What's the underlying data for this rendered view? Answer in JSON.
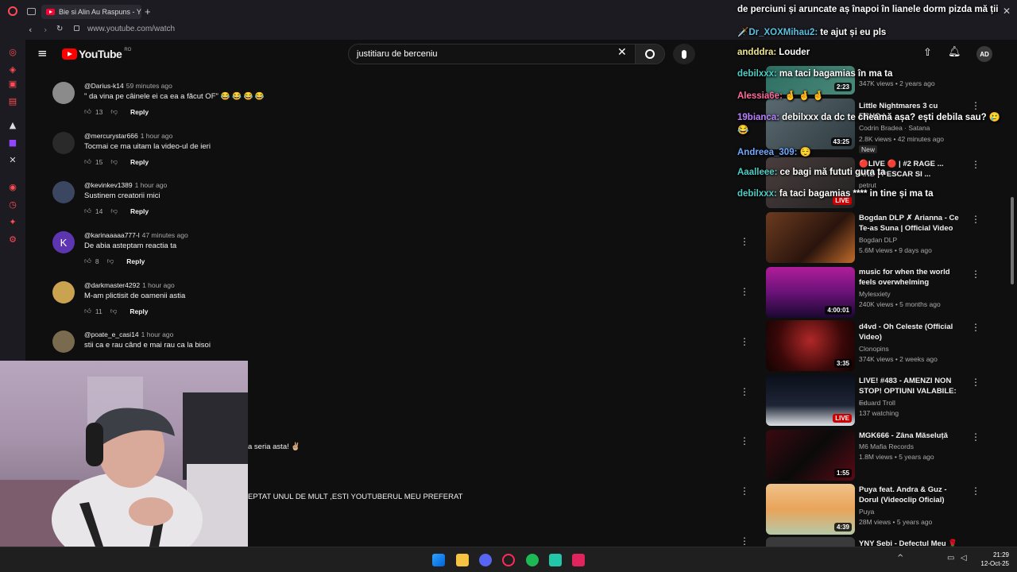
{
  "browser": {
    "tab_title": "Bie si Alin Au Raspuns - Y",
    "url": "www.youtube.com/watch",
    "tab_plus": "+"
  },
  "youtube": {
    "logo_text": "YouTube",
    "region": "RO",
    "search_value": "justitiaru de berceniu",
    "avatar_initials": "AD"
  },
  "comments": [
    {
      "user": "@Darius-k14",
      "time": "59 minutes ago",
      "text": "\" da vina pe câinele ei ca ea a făcut OF\" 😂 😂 😂 😂",
      "likes": "13",
      "reply": "Reply",
      "avatar": ""
    },
    {
      "user": "@mercurystar666",
      "time": "1 hour ago",
      "text": "Tocmai ce ma uitam la video-ul de ieri",
      "likes": "15",
      "reply": "Reply",
      "avatar": ""
    },
    {
      "user": "@kevinkev1389",
      "time": "1 hour ago",
      "text": "Sustinem creatorii mici",
      "likes": "14",
      "reply": "Reply",
      "avatar": ""
    },
    {
      "user": "@karinaaaaa777-l",
      "time": "47 minutes ago",
      "text": "De abia asteptam reactia ta",
      "likes": "8",
      "reply": "Reply",
      "avatar": "K"
    },
    {
      "user": "@darkmaster4292",
      "time": "1 hour ago",
      "text": "M-am plictisit de oamenii astia",
      "likes": "11",
      "reply": "Reply",
      "avatar": ""
    },
    {
      "user": "@poate_e_casi14",
      "time": "1 hour ago",
      "text": "stii ca e rau când e mai rau ca la bisoi",
      "likes": "",
      "reply": "",
      "avatar": ""
    }
  ],
  "partial_comments": [
    "a seria asta! ✌🏼",
    "EPTAT UNUL DE MULT ,ESTI YOUTUBERUL MEU PREFERAT"
  ],
  "videos": [
    {
      "title": "",
      "channel": "",
      "stats": "347K views • 2 years ago",
      "duration": "2:23",
      "live": false
    },
    {
      "title": "Little Nightmares 3 cu ECHO | ...",
      "channel": "Codrin Bradea · Satana",
      "stats": "2.8K views • 42 minutes ago",
      "badge": "New",
      "duration": "43:25",
      "live": false
    },
    {
      "title": "🔴LIVE 🔴 | #2 RAGE ... AND | PESCAR SI ...",
      "channel": "petrut",
      "stats": "",
      "duration": "",
      "live": true,
      "live_label": "LIVE"
    },
    {
      "title": "Bogdan DLP ✗ Arianna - Ce Te-as Suna | Official Video",
      "channel": "Bogdan DLP",
      "stats": "5.6M views • 9 days ago",
      "duration": "",
      "live": false
    },
    {
      "title": "music for when the world feels overwhelming",
      "channel": "Mylesxiety",
      "stats": "240K views • 5 months ago",
      "duration": "4:00:01",
      "live": false
    },
    {
      "title": "d4vd - Oh Celeste (Official Video)",
      "channel": "Clonopins",
      "stats": "374K views • 2 weeks ago",
      "duration": "3:35",
      "live": false
    },
    {
      "title": "LIVE! #483 - AMENZI NON STOP! OPTIUNI VALABILE: ...",
      "channel": "Eduard Troll",
      "stats": "137 watching",
      "duration": "",
      "live": true,
      "live_label": "LIVE"
    },
    {
      "title": "MGK666 - Zâna Măseluță",
      "channel": "M6 Mafia Records",
      "stats": "1.8M views • 5 years ago",
      "duration": "1:55",
      "live": false
    },
    {
      "title": "Puya feat. Andra & Guz - Dorul (Videoclip Oficial)",
      "channel": "Puya",
      "stats": "28M views • 5 years ago",
      "duration": "4:39",
      "live": false
    },
    {
      "title": "YNY Sebi - Defectul Meu 🌹",
      "channel": "",
      "stats": "",
      "duration": "",
      "live": false
    }
  ],
  "chat": [
    {
      "user": "",
      "message": "de perciuni și aruncate aș înapoi în lianele dorm pizda mă ții",
      "color": "#ffffff"
    },
    {
      "user": "🗡️Dr_XOXMihau2:",
      "message": "te ajut și eu pls",
      "color": "#5bc0de"
    },
    {
      "user": "andddra:",
      "message": "Louder",
      "color": "#f0e68c"
    },
    {
      "user": "debilxxx:",
      "message": "ma taci bagamias în ma ta",
      "color": "#4ecdc4"
    },
    {
      "user": "Alessia6e:",
      "message": "🤞 🤞 🤞",
      "color": "#ff6b9d"
    },
    {
      "user": "19bianca:",
      "message": "debilxxx da dc te cheamă așa? ești debila sau? 🥲 😂",
      "color": "#b983ff"
    },
    {
      "user": "Andreea_309:",
      "message": "😌",
      "color": "#6fa8ff"
    },
    {
      "user": "Aaalleee:",
      "message": "ce bagi mă fututi gura ta",
      "color": "#4ecdc4"
    },
    {
      "user": "debilxxx:",
      "message": "fa taci bagamias **** in tine și ma ta",
      "color": "#4ecdc4"
    }
  ],
  "taskbar": {
    "time": "21:29",
    "date": "12-Oct-25"
  }
}
